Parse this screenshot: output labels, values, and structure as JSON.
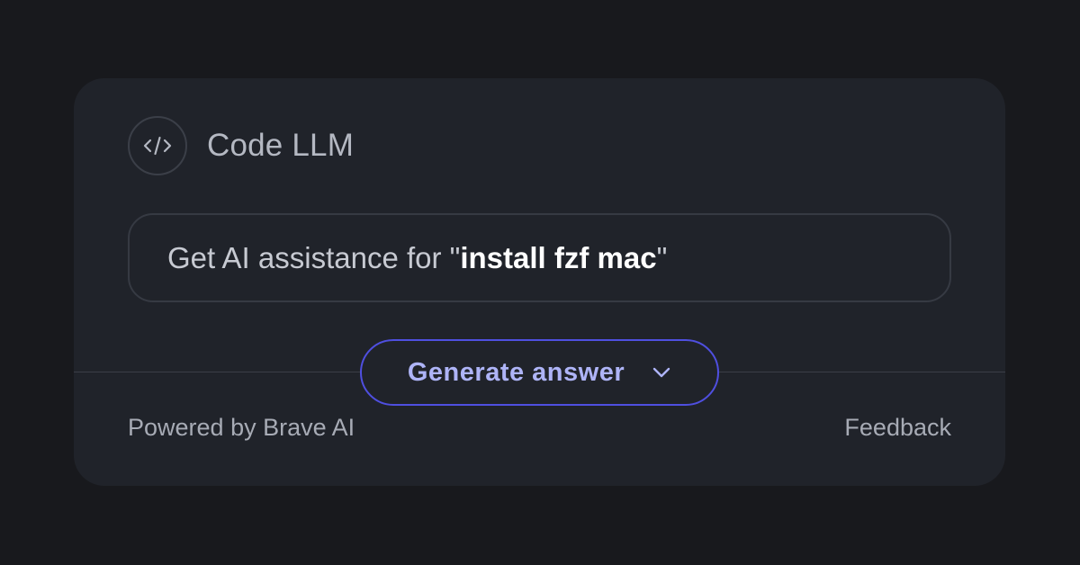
{
  "card": {
    "icon": "code-icon",
    "title": "Code LLM"
  },
  "prompt": {
    "prefix": "Get AI assistance for \"",
    "query": "install fzf mac",
    "suffix": "\""
  },
  "generate": {
    "label": "Generate answer",
    "icon": "chevron-down-icon"
  },
  "footer": {
    "powered_by": "Powered by Brave AI",
    "feedback": "Feedback"
  },
  "colors": {
    "background": "#18191d",
    "card": "#20232a",
    "accent_border": "#4f4fe0",
    "accent_text": "#aeb4f7"
  }
}
